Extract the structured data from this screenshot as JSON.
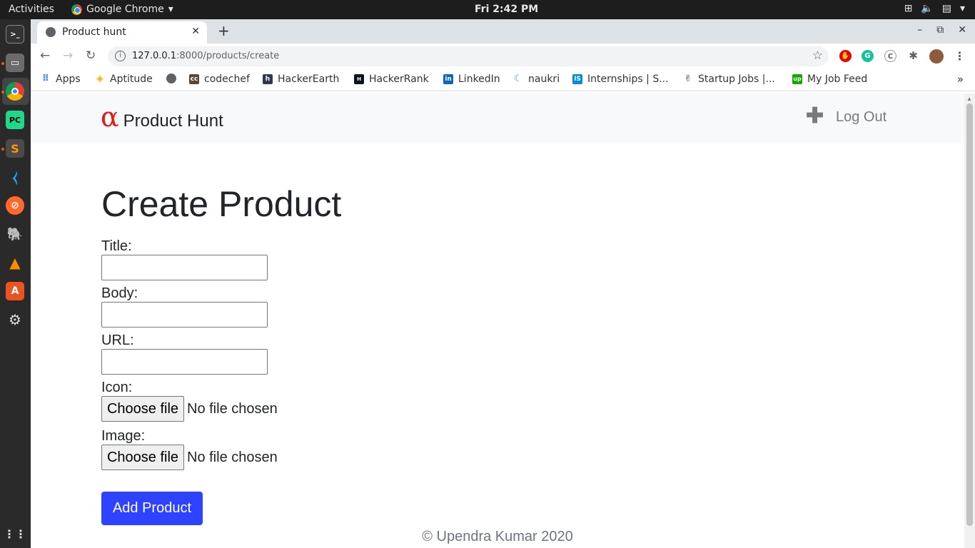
{
  "system_bar": {
    "activities": "Activities",
    "app_name": "Google Chrome",
    "app_menu_arrow": "▾",
    "clock": "Fri  2:42 PM",
    "tray_icons": [
      "network-icon",
      "volume-icon",
      "clipboard-icon",
      "menu-arrow-icon"
    ]
  },
  "dock": {
    "items": [
      "terminal-icon",
      "files-icon",
      "chrome-icon",
      "pycharm-icon",
      "sublime-icon",
      "vscode-icon",
      "safari-icon",
      "postgres-icon",
      "vlc-icon",
      "software-center-icon",
      "settings-icon",
      "show-apps-icon"
    ]
  },
  "browser": {
    "tab": {
      "title": "Product hunt",
      "close": "✕"
    },
    "new_tab": "+",
    "window_controls": {
      "minimize": "–",
      "maximize": "⧉",
      "close": "✕"
    },
    "url_host": "127.0.0.1",
    "url_path": ":8000/products/create",
    "bookmarks": [
      {
        "label": "Apps",
        "icon": "apps-grid-icon",
        "color": "#4285f4"
      },
      {
        "label": "Aptitude",
        "icon": "aptitude-icon",
        "color": "#f4b400"
      },
      {
        "label": "",
        "icon": "globe-icon",
        "color": "#5f6368"
      },
      {
        "label": "codechef",
        "icon": "codechef-icon",
        "color": "#5b4638"
      },
      {
        "label": "HackerEarth",
        "icon": "hackerearth-icon",
        "color": "#323754"
      },
      {
        "label": "HackerRank",
        "icon": "hackerrank-icon",
        "color": "#0e141e"
      },
      {
        "label": "LinkedIn",
        "icon": "linkedin-icon",
        "color": "#0a66c2"
      },
      {
        "label": "naukri",
        "icon": "naukri-icon",
        "color": "#4a90e2"
      },
      {
        "label": "Internships | S...",
        "icon": "internshala-icon",
        "color": "#008bdc"
      },
      {
        "label": "Startup Jobs |...",
        "icon": "angellist-icon",
        "color": "#333333"
      },
      {
        "label": "My Job Feed",
        "icon": "upwork-icon",
        "color": "#14a800"
      }
    ],
    "bookmarks_overflow": "»"
  },
  "page": {
    "brand_logo": "α",
    "brand_name": "Product Hunt",
    "nav_add": "✚",
    "nav_logout": "Log Out",
    "title": "Create Product",
    "form": {
      "title_label": "Title:",
      "title_value": "",
      "body_label": "Body:",
      "body_value": "",
      "url_label": "URL:",
      "url_value": "",
      "icon_label": "Icon:",
      "image_label": "Image:",
      "choose_file": "Choose file",
      "no_file": "No file chosen",
      "submit": "Add Product"
    },
    "footer": "© Upendra Kumar 2020",
    "accent_color": "#2e43ff",
    "logo_color": "#e21b1b"
  }
}
